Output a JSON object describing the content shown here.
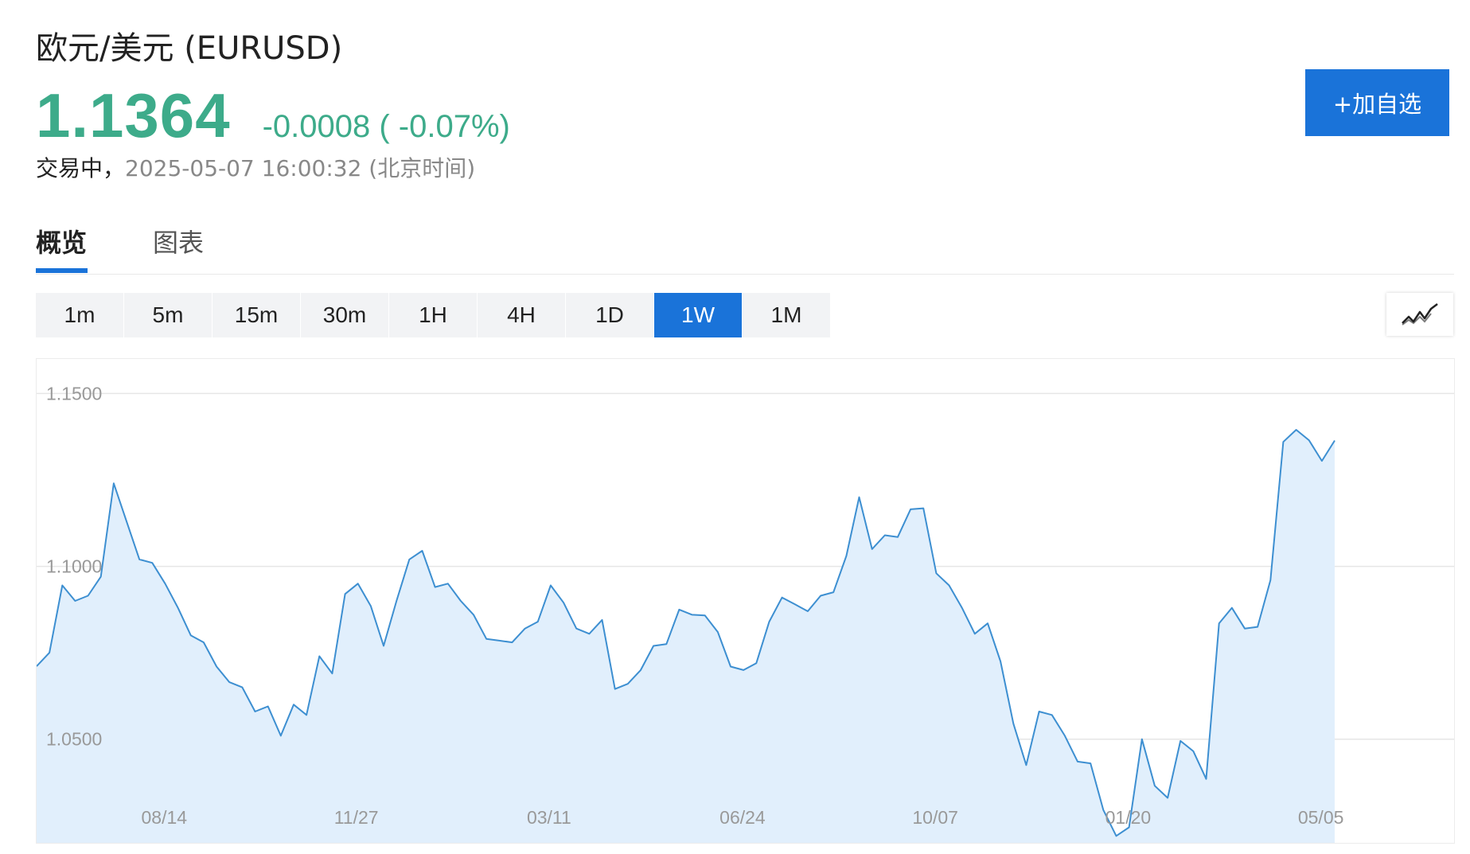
{
  "header": {
    "title": "欧元/美元 (EURUSD)",
    "price": "1.1364",
    "change": "-0.0008 ( -0.07%)",
    "status_label": "交易中，",
    "timestamp": "2025-05-07 16:00:32 (北京时间)",
    "add_button": "+加自选"
  },
  "tabs": [
    {
      "label": "概览",
      "active": true
    },
    {
      "label": "图表",
      "active": false
    }
  ],
  "periods": [
    {
      "label": "1m",
      "active": false
    },
    {
      "label": "5m",
      "active": false
    },
    {
      "label": "15m",
      "active": false
    },
    {
      "label": "30m",
      "active": false
    },
    {
      "label": "1H",
      "active": false
    },
    {
      "label": "4H",
      "active": false
    },
    {
      "label": "1D",
      "active": false
    },
    {
      "label": "1W",
      "active": true
    },
    {
      "label": "1M",
      "active": false
    }
  ],
  "chart_type_icon": "line-chart-icon",
  "colors": {
    "up_green": "#3dab8a",
    "accent_blue": "#1a73d9",
    "line": "#3d8fd1",
    "area_fill": "#e1effc"
  },
  "chart_data": {
    "type": "area",
    "ylim": [
      1.02,
      1.16
    ],
    "y_ticks": [
      "1.1500",
      "1.1000",
      "1.0500"
    ],
    "x_tick_labels": [
      {
        "label": "08/14",
        "index": 10
      },
      {
        "label": "11/27",
        "index": 25
      },
      {
        "label": "03/11",
        "index": 40
      },
      {
        "label": "06/24",
        "index": 55
      },
      {
        "label": "10/07",
        "index": 70
      },
      {
        "label": "01/20",
        "index": 85
      },
      {
        "label": "05/05",
        "index": 100
      }
    ],
    "grid": true,
    "series": [
      {
        "values": [
          1.0711,
          1.075,
          1.0945,
          1.09,
          1.0915,
          1.097,
          1.124,
          1.113,
          1.102,
          1.101,
          1.095,
          1.088,
          1.08,
          1.078,
          1.071,
          1.0665,
          1.065,
          1.058,
          1.0595,
          1.051,
          1.06,
          1.057,
          1.074,
          1.069,
          1.092,
          1.095,
          1.0885,
          1.077,
          1.09,
          1.102,
          1.1045,
          1.094,
          1.095,
          1.09,
          1.086,
          1.079,
          1.0785,
          1.078,
          1.082,
          1.084,
          1.0945,
          1.0895,
          1.082,
          1.0805,
          1.0845,
          1.0645,
          1.066,
          1.07,
          1.077,
          1.0775,
          1.0875,
          1.086,
          1.0858,
          1.081,
          1.071,
          1.07,
          1.072,
          1.084,
          1.091,
          1.089,
          1.087,
          1.0915,
          1.0925,
          1.103,
          1.12,
          1.105,
          1.109,
          1.1085,
          1.1165,
          1.1168,
          1.098,
          1.0945,
          1.088,
          1.0805,
          1.0835,
          1.0725,
          1.0545,
          1.0425,
          1.058,
          1.057,
          1.051,
          1.0435,
          1.043,
          1.0295,
          1.022,
          1.0245,
          1.05,
          1.0365,
          1.033,
          1.0495,
          1.0465,
          1.0385,
          1.0835,
          1.088,
          1.082,
          1.0825,
          1.096,
          1.136,
          1.1395,
          1.1365,
          1.1305,
          1.1364
        ]
      }
    ]
  }
}
